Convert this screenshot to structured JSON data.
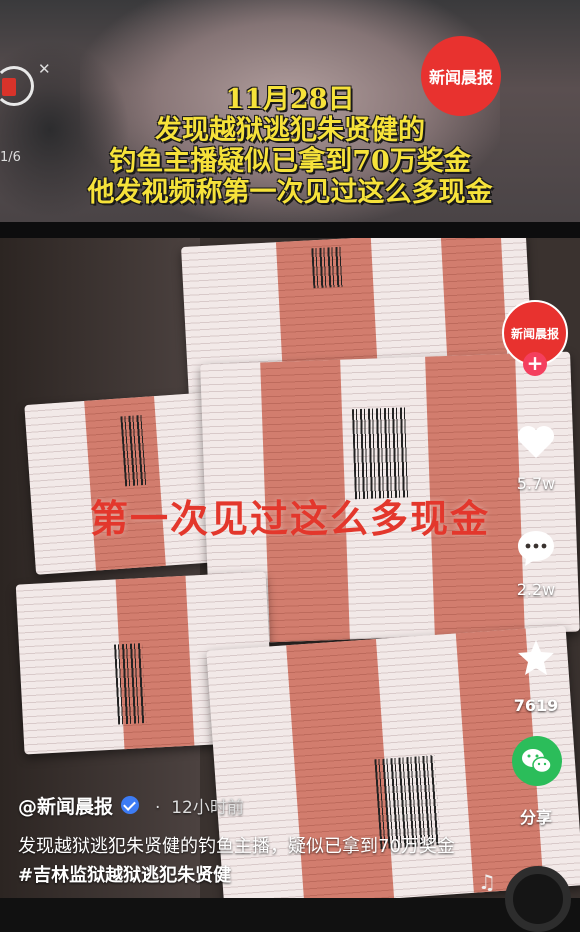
{
  "header": {
    "headline_lines": [
      "11月28日",
      "发现越狱逃犯朱贤健的",
      "钓鱼主播疑似已拿到70万奖金",
      "他发视频称第一次见过这么多现金"
    ],
    "logo_text": "新闻晨报",
    "mini_counter": "1/6"
  },
  "video": {
    "overlay_caption": "第一次见过这么多现金"
  },
  "actions": {
    "avatar_text": "新闻晨报",
    "like_count": "5.7w",
    "comment_count": "2.2w",
    "favorite_count": "7619",
    "share_label": "分享"
  },
  "caption": {
    "author": "@新闻晨报",
    "time_ago": "12小时前",
    "description": "发现越狱逃犯朱贤健的钓鱼主播，疑似已拿到70万奖金",
    "hashtag": "#吉林监狱越狱逃犯朱贤健"
  },
  "colors": {
    "headline": "#f6e23a",
    "overlay": "#e3372c",
    "brand": "#e8322f",
    "verified": "#3d7cf5",
    "wechat": "#2bbd5a"
  },
  "icons": [
    "heart-icon",
    "comment-icon",
    "star-icon",
    "wechat-icon",
    "music-note-icon",
    "close-icon",
    "verified-icon"
  ]
}
